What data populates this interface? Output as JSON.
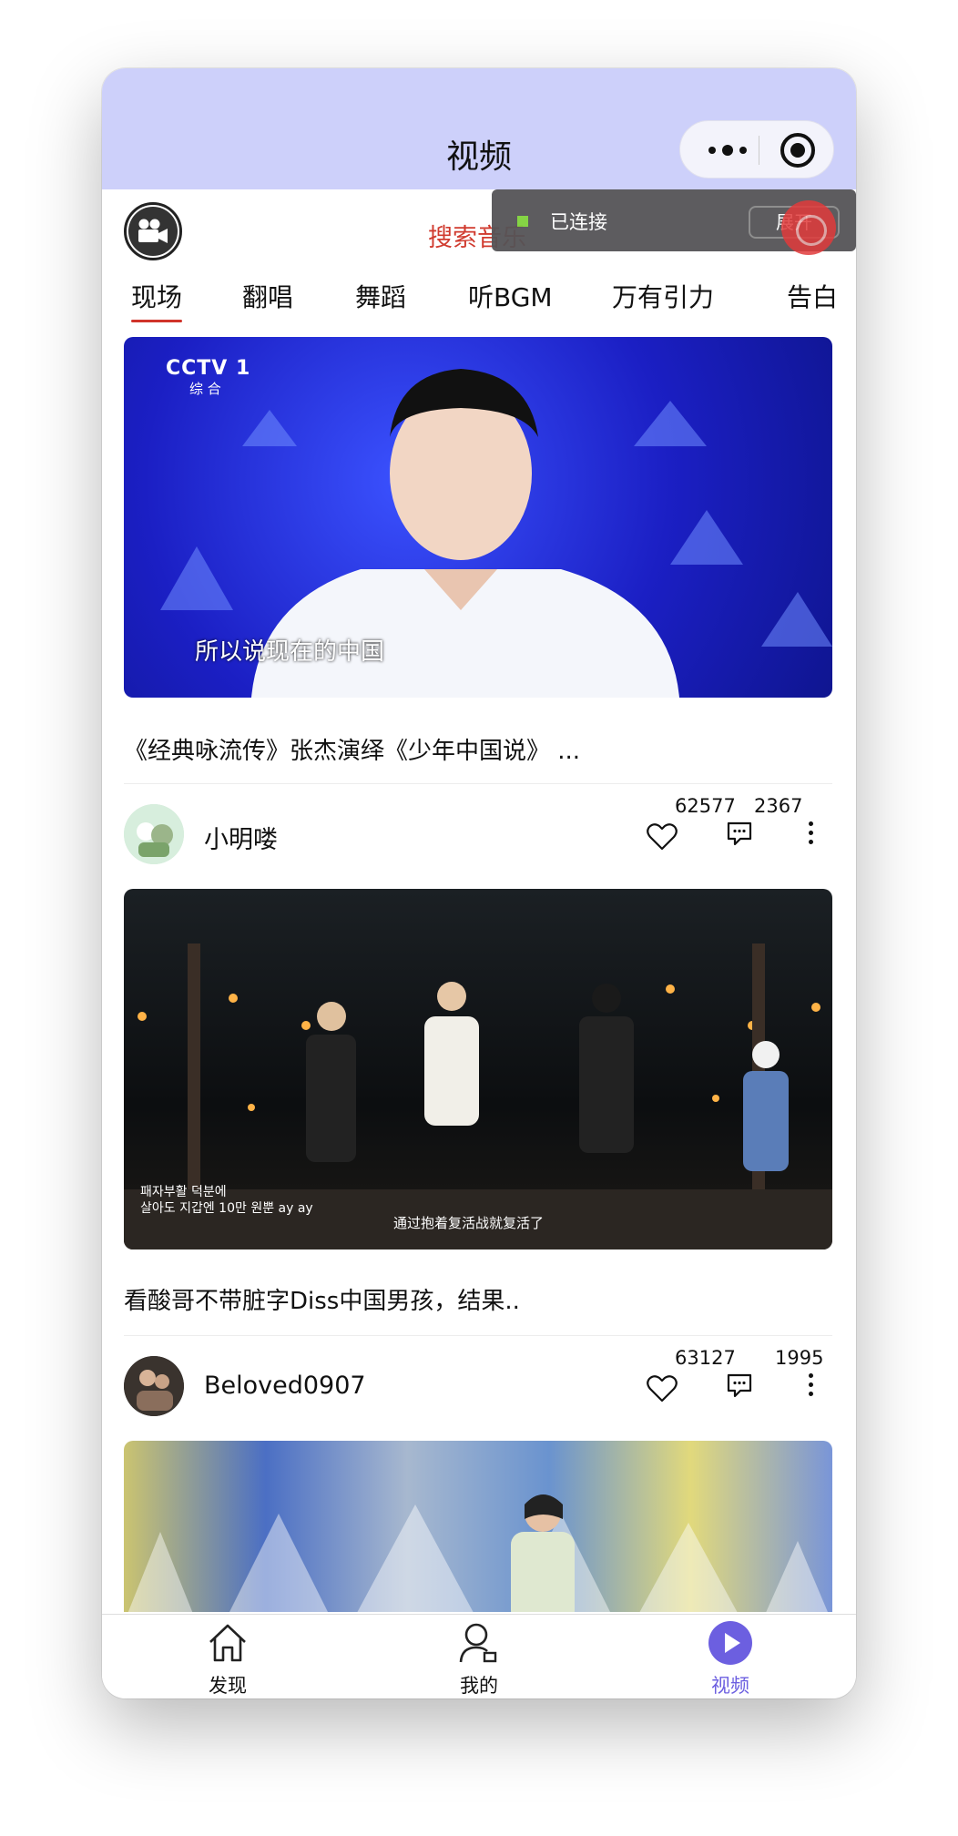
{
  "navbar": {
    "title": "视频"
  },
  "search": {
    "text": "搜索音乐"
  },
  "connection": {
    "status": "已连接",
    "expand_label": "展开"
  },
  "tabs": [
    {
      "label": "现场",
      "active": true
    },
    {
      "label": "翻唱",
      "active": false
    },
    {
      "label": "舞蹈",
      "active": false
    },
    {
      "label": "听BGM",
      "active": false
    },
    {
      "label": "万有引力",
      "active": false
    },
    {
      "label": "告白",
      "active": false
    }
  ],
  "videos": [
    {
      "overlay_logo": "CCTV 1",
      "overlay_logo_sub": "综 合",
      "overlay_subtitle": "所以说现在的中国",
      "title": "《经典咏流传》张杰演绎《少年中国说》 ...",
      "user": "小明喽",
      "likes": "62577",
      "comments": "2367"
    },
    {
      "overlay_caption_1": "패자부활 덕분에",
      "overlay_caption_2": "살아도 지갑엔 10만 원뿐 ay ay",
      "overlay_subtitle": "通过抱着复活战就复活了",
      "title": "看酸哥不带脏字Diss中国男孩，结果..",
      "user": "Beloved0907",
      "likes": "63127",
      "comments": "1995"
    }
  ],
  "tabbar": {
    "items": [
      {
        "label": "发现",
        "icon": "home-icon",
        "active": false
      },
      {
        "label": "我的",
        "icon": "user-icon",
        "active": false
      },
      {
        "label": "视频",
        "icon": "play-icon",
        "active": true
      }
    ],
    "accent": "#6c5fe0"
  },
  "colors": {
    "navbar_bg": "#cdd0fa",
    "search_text": "#d03a2e",
    "tab_indicator": "#d0332a"
  }
}
